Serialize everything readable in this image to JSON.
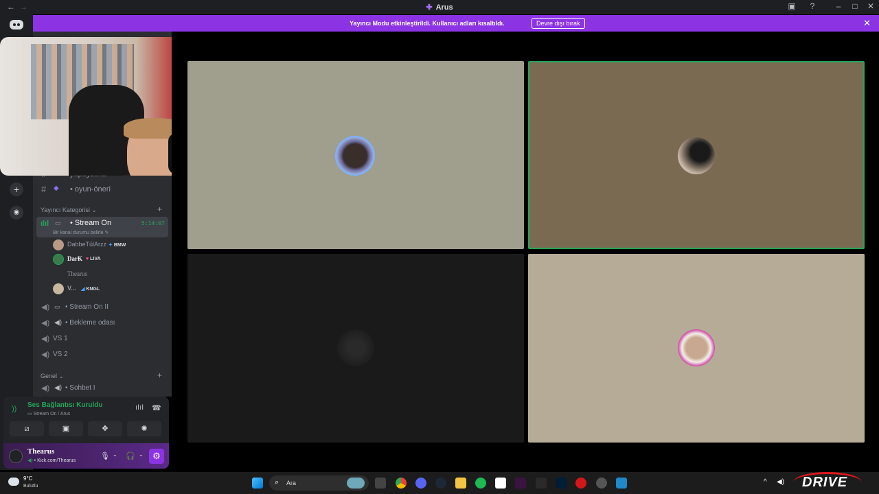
{
  "titlebar": {
    "back": "←",
    "forward": "→",
    "title": "Arus",
    "title_icon": "✚"
  },
  "banner": {
    "message": "Yayıncı Modu etkinleştirildi. Kullanıcı adları kısaltıldı.",
    "button": "Devre dışı bırak",
    "close": "✕"
  },
  "rail": {
    "add": "+",
    "explore": "◉"
  },
  "channels": {
    "partial_top": "yapayzeka",
    "text_channel": "oyun-öneri",
    "category1": "Yayıncı Kategorisi",
    "active_voice": {
      "name": "Stream On",
      "timer": "5:14:07",
      "status": "Bir kanal durumu belirle"
    },
    "members": [
      {
        "name": "DabbeTülArzz",
        "tag": "BMW",
        "tag_color": "#4aa3ff"
      },
      {
        "name": "DarK",
        "tag": "LIVA",
        "tag_color": "#ff5a8a"
      },
      {
        "name": "Thearus",
        "tag": "",
        "tag_color": ""
      },
      {
        "name": "V...",
        "tag": "KNGL",
        "tag_color": "#4aa3ff"
      }
    ],
    "voice": [
      {
        "name": "Stream On II"
      },
      {
        "name": "Bekleme odası"
      },
      {
        "name": "VS 1"
      },
      {
        "name": "VS 2"
      }
    ],
    "category2": "Genel",
    "voice2": "Sohbet I"
  },
  "voice_panel": {
    "status": "Ses Bağlantısı Kuruldu",
    "location": "Stream On / Arus",
    "user": {
      "name": "Thearus",
      "status": "Kick.com/Thearus"
    }
  },
  "taskbar": {
    "temp": "9°C",
    "condition": "Bulutlu",
    "search": "Ara",
    "brand": "DRIVE"
  },
  "colors": {
    "accent": "#8c34e3",
    "green": "#23a55a",
    "tile1": "#a09e8c",
    "tile2": "#7b6a52",
    "tile3": "#1a1a1a",
    "tile4": "#b6ab97"
  }
}
